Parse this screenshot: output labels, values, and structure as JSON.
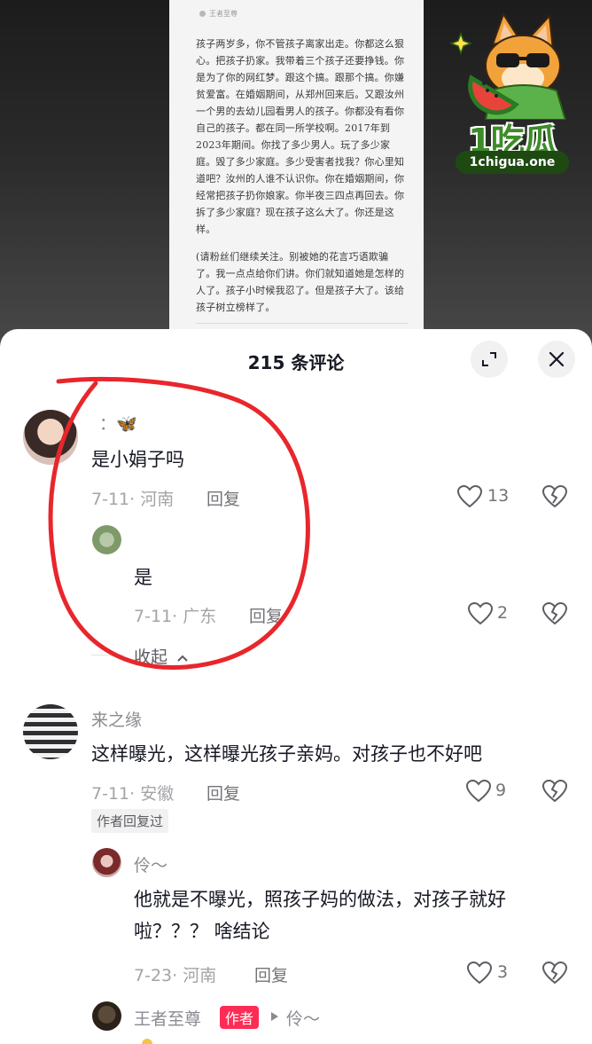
{
  "post": {
    "author": "王者至尊",
    "paragraphs": [
      "孩子两岁多，你不管孩子离家出走。你都这么狠心。把孩子扔家。我带着三个孩子还要挣钱。你是为了你的网红梦。跟这个搞。跟那个搞。你嫌贫爱富。在婚姻期间，从郑州回来后。又跟汝州一个男的去幼儿园看男人的孩子。你都没有看你自己的孩子。都在同一所学校啊。2017年到2023年期间。你找了多少男人。玩了多少家庭。毁了多少家庭。多少受害者找我？你心里知道吧？汝州的人谁不认识你。你在婚姻期间，你经常把孩子扔你娘家。你半夜三四点再回去。你拆了多少家庭？现在孩子这么大了。你还是这样。",
      "(请粉丝们继续关注。别被她的花言巧语欺骗了。我一点点给你们讲。你们就知道她是怎样的人了。孩子小时候我忍了。但是孩子大了。该给孩子树立榜样了。"
    ]
  },
  "watermark": {
    "title": "1吃瓜",
    "site": "1chigua.one"
  },
  "sheet": {
    "title": "215 条评论",
    "expand_icon": "expand-icon",
    "close_icon": "close-icon"
  },
  "comments": [
    {
      "username": "：🦋",
      "content": "是小娟子吗",
      "date": "7-11",
      "location": "· 河南",
      "reply_label": "回复",
      "likes": "13",
      "replies": [
        {
          "username": "",
          "content": "是",
          "date": "7-11",
          "location": "· 广东",
          "reply_label": "回复",
          "likes": "2"
        }
      ],
      "collapse_label": "收起"
    },
    {
      "username": "来之缘",
      "content": "这样曝光，这样曝光孩子亲妈。对孩子也不好吧",
      "date": "7-11",
      "location": "· 安徽",
      "reply_label": "回复",
      "likes": "9",
      "badge": "作者回复过",
      "replies": [
        {
          "username": "伶～",
          "content": "他就是不曝光，照孩子妈的做法，对孩子就好啦？？？ 啥结论",
          "date": "7-23",
          "location": "· 河南",
          "reply_label": "回复",
          "likes": "3"
        },
        {
          "username": "王者至尊",
          "author_tag": "作者",
          "reply_to": "伶～"
        }
      ]
    }
  ],
  "colors": {
    "accent_red": "#fe2c55",
    "annotation_red": "#e8262c",
    "text_primary": "#161823",
    "text_secondary": "#8a8b91"
  }
}
